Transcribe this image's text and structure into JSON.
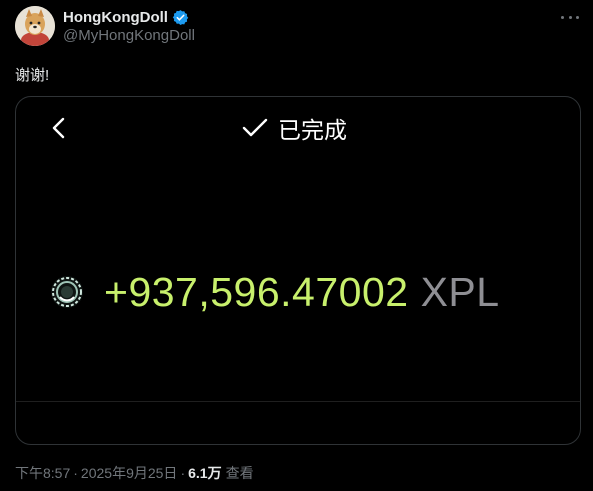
{
  "author": {
    "display_name": "HongKongDoll",
    "handle": "@MyHongKongDoll",
    "verified": true,
    "verified_color": "#1d9bf0"
  },
  "post": {
    "text": "谢谢!"
  },
  "card": {
    "status_text": "已完成",
    "amount": "+937,596.47002",
    "unit": "XPL",
    "amount_color": "#c8f06c",
    "unit_color": "#8e8e93"
  },
  "meta": {
    "time": "下午8:57",
    "separator": "·",
    "date": "2025年9月25日",
    "views_count": "6.1万",
    "views_label": "查看"
  },
  "icons": {
    "more": "more-options-icon",
    "verified": "verified-badge-icon",
    "back": "chevron-left-icon",
    "check": "check-icon",
    "token": "token-logo-icon"
  }
}
